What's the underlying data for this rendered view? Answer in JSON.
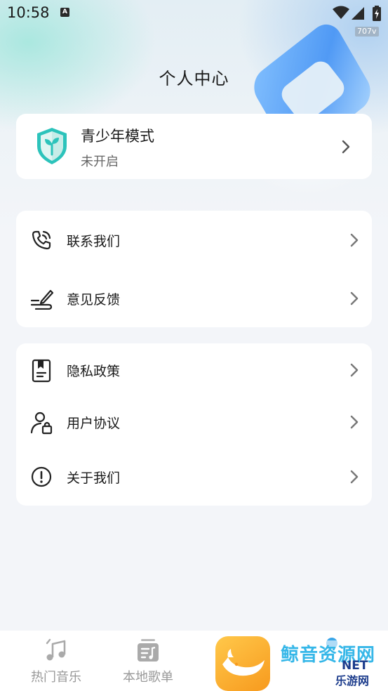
{
  "status_bar": {
    "time": "10:58",
    "notification_icon": "A",
    "net_speed": "707v"
  },
  "header": {
    "title": "个人中心"
  },
  "youth_mode": {
    "title": "青少年模式",
    "status": "未开启",
    "icon": "shield-plant-icon",
    "accent": "#2cc3bb"
  },
  "menu_group_1": {
    "items": [
      {
        "label": "联系我们",
        "icon": "phone-icon"
      },
      {
        "label": "意见反馈",
        "icon": "pen-feedback-icon"
      }
    ]
  },
  "menu_group_2": {
    "items": [
      {
        "label": "隐私政策",
        "icon": "privacy-book-icon"
      },
      {
        "label": "用户协议",
        "icon": "user-lock-icon"
      },
      {
        "label": "关于我们",
        "icon": "info-exclamation-icon"
      }
    ]
  },
  "bottom_nav": {
    "items": [
      {
        "label": "热门音乐",
        "icon": "music-note-icon"
      },
      {
        "label": "本地歌单",
        "icon": "playlist-icon"
      },
      {
        "label": "",
        "icon": "whale-logo-icon"
      },
      {
        "label": "",
        "icon": "profile-icon"
      }
    ]
  },
  "watermark": {
    "line1": "鲸音资源网",
    "line2": "NET",
    "line3": "乐游网"
  }
}
